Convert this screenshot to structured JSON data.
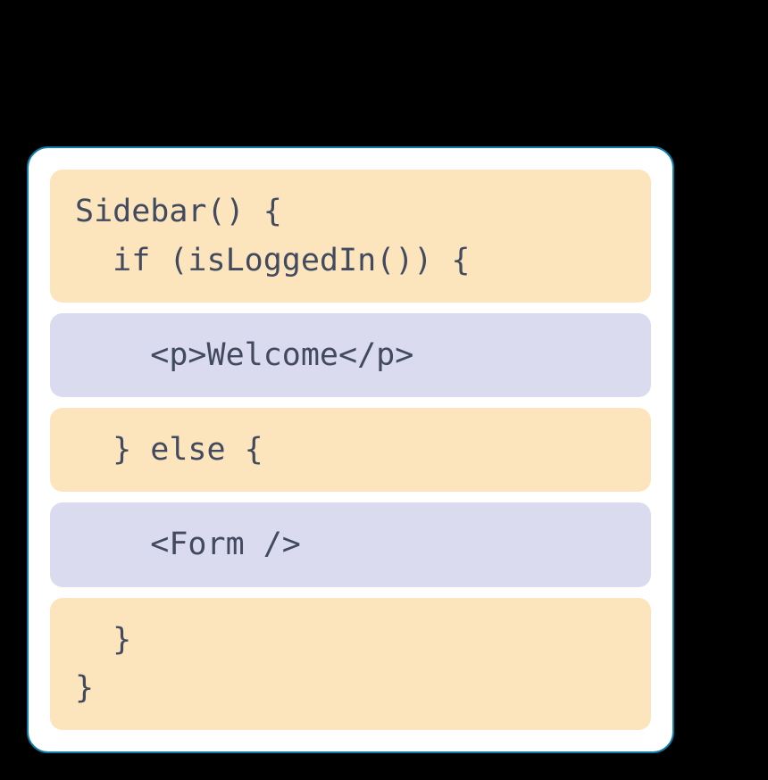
{
  "code": {
    "blocks": [
      {
        "type": "orange",
        "text": "Sidebar() {\n  if (isLoggedIn()) {"
      },
      {
        "type": "purple",
        "text": "    <p>Welcome</p>"
      },
      {
        "type": "orange",
        "text": "  } else {"
      },
      {
        "type": "purple",
        "text": "    <Form />"
      },
      {
        "type": "orange",
        "text": "  }\n}"
      }
    ]
  },
  "colors": {
    "card_border": "#0d7ea8",
    "card_bg": "#ffffff",
    "orange_bg": "#fce4bc",
    "purple_bg": "#dbdbf0",
    "text": "#414a5e",
    "page_bg": "#000000"
  }
}
